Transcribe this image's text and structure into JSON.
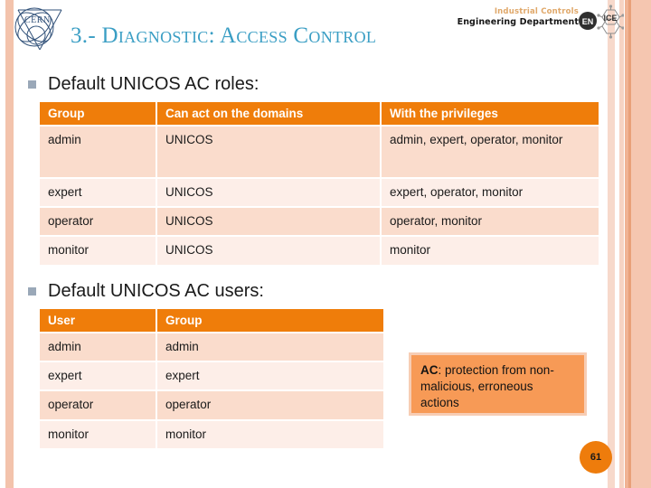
{
  "slide": {
    "title": "3.- Diagnostic: Access Control",
    "page_number": "61",
    "logo_text": "CERN"
  },
  "header": {
    "dept_line1": "Industrial Controls",
    "dept_line2": "Engineering Department",
    "enice_left_label": "EN",
    "enice_right_label": "ICE"
  },
  "sections": {
    "roles_heading": "Default UNICOS AC roles:",
    "users_heading": "Default UNICOS AC users:"
  },
  "roles_table": {
    "headers": [
      "Group",
      "Can act on the domains",
      "With the privileges"
    ],
    "rows": [
      [
        "admin",
        "UNICOS",
        "admin, expert, operator, monitor"
      ],
      [
        "expert",
        "UNICOS",
        "expert, operator, monitor"
      ],
      [
        "operator",
        "UNICOS",
        "operator, monitor"
      ],
      [
        "monitor",
        "UNICOS",
        "monitor"
      ]
    ]
  },
  "users_table": {
    "headers": [
      "User",
      "Group"
    ],
    "rows": [
      [
        "admin",
        "admin"
      ],
      [
        "expert",
        "expert"
      ],
      [
        "operator",
        "operator"
      ],
      [
        "monitor",
        "monitor"
      ]
    ]
  },
  "callout": {
    "strong": "AC",
    "rest": ": protection from non-malicious, erroneous actions"
  },
  "colors": {
    "accent_orange": "#ef7d0a",
    "title_blue": "#3a9ec4",
    "row_dark": "#fadccc",
    "row_light": "#fdeee8",
    "callout_bg": "#f79a56",
    "callout_border": "#f7cdb4",
    "stripe_peach": "#f3c3ac"
  }
}
